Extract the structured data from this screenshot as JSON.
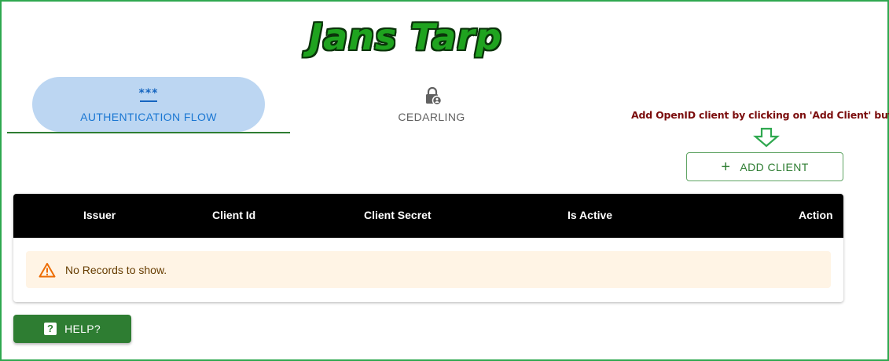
{
  "app": {
    "title": "Jans Tarp"
  },
  "tabs": [
    {
      "label": "AUTHENTICATION FLOW",
      "icon": "password-dots-icon",
      "selected": true
    },
    {
      "label": "CEDARLING",
      "icon": "lock-person-icon",
      "selected": false
    }
  ],
  "hint": {
    "text": "Add OpenID client by clicking on 'Add Client' button."
  },
  "toolbar": {
    "add_client_label": "ADD CLIENT",
    "add_icon": "plus-icon"
  },
  "table": {
    "columns": [
      "Issuer",
      "Client Id",
      "Client Secret",
      "Is Active",
      "Action"
    ],
    "rows": [],
    "empty_message": "No Records to show."
  },
  "help": {
    "label": "HELP?",
    "icon": "help-icon"
  },
  "colors": {
    "accent_green": "#2e7d32",
    "tab_selected_bg": "#bcd6f2",
    "tab_selected_text": "#1976d2",
    "hint_text": "#7b0d0d",
    "header_bg": "#000000",
    "empty_bg": "#fff4e5",
    "frame_border": "#2fa84f"
  }
}
